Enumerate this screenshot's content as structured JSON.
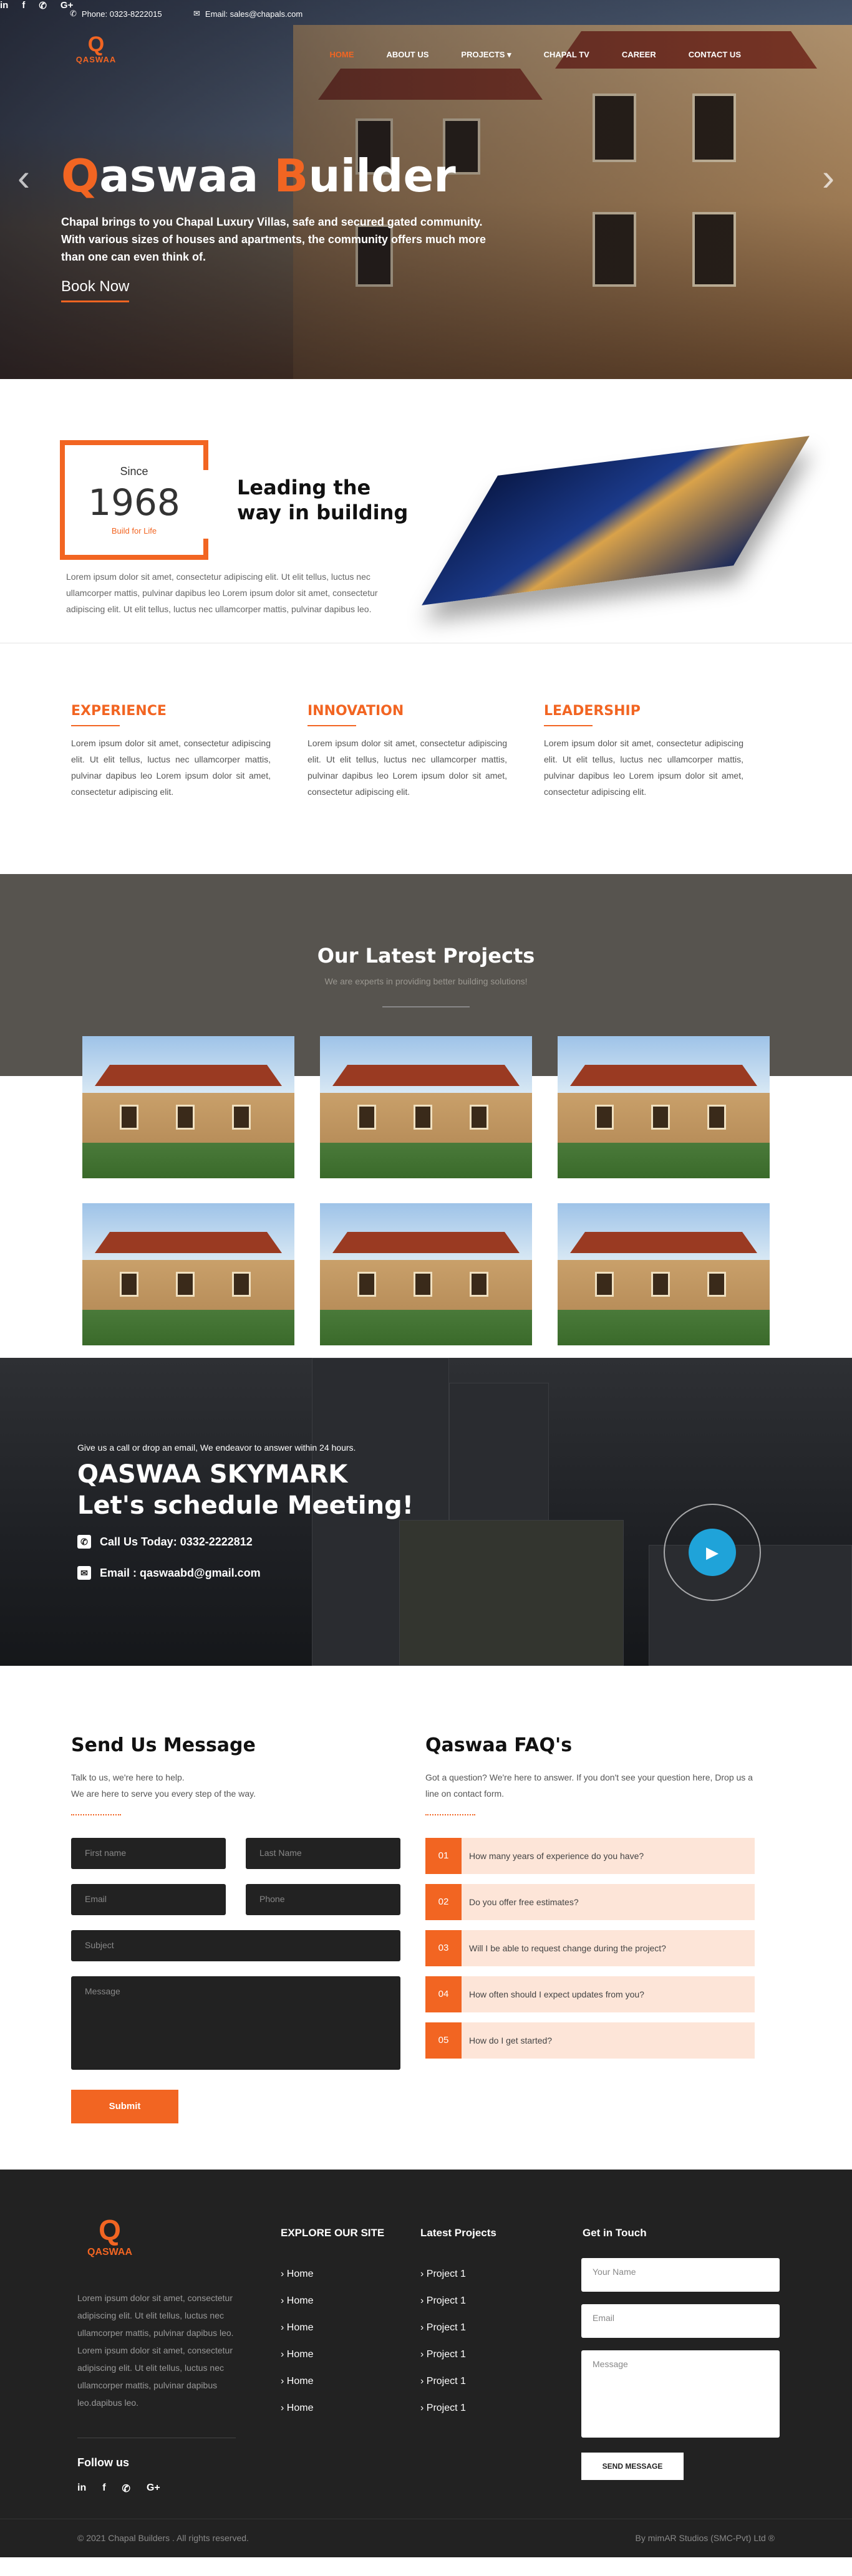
{
  "topbar": {
    "phone": "Phone: 0323-8222015",
    "email": "Email: sales@chapals.com",
    "social": [
      "in",
      "f",
      "✆",
      "G+"
    ]
  },
  "header": {
    "logo_mark": "Q",
    "logo_text": "QASWAA",
    "nav": [
      "HOME",
      "ABOUT US",
      "PROJECTS ▾",
      "CHAPAL TV",
      "CAREER",
      "CONTACT US"
    ]
  },
  "hero": {
    "title_q": "Q",
    "title_rest1": "aswaa ",
    "title_b": "B",
    "title_rest2": "uilder",
    "subtitle": "Chapal brings to you Chapal Luxury Villas, safe and secured gated community. With various sizes of houses and apartments, the community offers much more than one can even think of.",
    "button": "Book Now"
  },
  "about": {
    "since_label": "Since",
    "since_year": "1968",
    "since_tag": "Build for Life",
    "heading_l1": "Leading the",
    "heading_l2": "way in building",
    "text": "Lorem ipsum dolor sit amet, consectetur adipiscing elit. Ut elit tellus, luctus nec ullamcorper mattis, pulvinar dapibus leo Lorem ipsum dolor sit amet, consectetur adipiscing elit. Ut elit tellus, luctus nec ullamcorper mattis, pulvinar dapibus leo."
  },
  "features": [
    {
      "title": "EXPERIENCE",
      "text": "Lorem ipsum dolor sit amet, consectetur adipiscing elit. Ut elit tellus, luctus nec ullamcorper mattis, pulvinar dapibus leo Lorem ipsum dolor sit amet, consectetur adipiscing elit."
    },
    {
      "title": "INNOVATION",
      "text": "Lorem ipsum dolor sit amet, consectetur adipiscing elit. Ut elit tellus, luctus nec ullamcorper mattis, pulvinar dapibus leo Lorem ipsum dolor sit amet, consectetur adipiscing elit."
    },
    {
      "title": "LEADERSHIP",
      "text": "Lorem ipsum dolor sit amet, consectetur adipiscing elit. Ut elit tellus, luctus nec ullamcorper mattis, pulvinar dapibus leo Lorem ipsum dolor sit amet, consectetur adipiscing elit."
    }
  ],
  "projects": {
    "title": "Our Latest Projects",
    "subtitle": "We are experts in providing better building solutions!"
  },
  "meeting": {
    "intro": "Give us a call or drop an email, We endeavor to answer within 24 hours.",
    "title_l1": "QASWAA SKYMARK",
    "title_l2": "Let's schedule Meeting!",
    "call": "Call Us Today: 0332-2222812",
    "email": "Email : qaswaabd@gmail.com"
  },
  "contact": {
    "title": "Send Us Message",
    "desc_l1": "Talk to us, we're here to help.",
    "desc_l2": "We are here to serve you every step of the way.",
    "first_name": "First name",
    "last_name": "Last Name",
    "email": "Email",
    "phone": "Phone",
    "subject": "Subject",
    "message": "Message",
    "submit": "Submit"
  },
  "faq": {
    "title": "Qaswaa FAQ's",
    "desc": "Got a question? We're here to answer. If you don't see your question here, Drop us a line on contact form.",
    "items": [
      {
        "n": "01",
        "q": "How many years of experience do you have?"
      },
      {
        "n": "02",
        "q": "Do you offer free estimates?"
      },
      {
        "n": "03",
        "q": "Will I be able to request change during the project?"
      },
      {
        "n": "04",
        "q": "How often should I expect updates from you?"
      },
      {
        "n": "05",
        "q": "How do I get started?"
      }
    ]
  },
  "footer": {
    "logo_mark": "Q",
    "logo_text": "QASWAA",
    "about": "Lorem ipsum dolor sit amet, consectetur adipiscing elit. Ut elit tellus, luctus nec ullamcorper mattis, pulvinar dapibus leo. Lorem ipsum dolor sit amet, consectetur adipiscing elit. Ut elit tellus, luctus nec ullamcorper mattis, pulvinar dapibus leo.dapibus leo.",
    "follow": "Follow us",
    "social": [
      "in",
      "f",
      "✆",
      "G+"
    ],
    "explore_title": "EXPLORE OUR SITE",
    "explore": [
      "Home",
      "Home",
      "Home",
      "Home",
      "Home",
      "Home"
    ],
    "latest_title": "Latest Projects",
    "latest": [
      "Project 1",
      "Project 1",
      "Project 1",
      "Project 1",
      "Project 1",
      "Project 1"
    ],
    "touch_title": "Get in Touch",
    "your_name": "Your Name",
    "email": "Email",
    "message": "Message",
    "send": "SEND MESSAGE",
    "copyright": "© 2021 Chapal Builders . All rights reserved.",
    "credit": "By mimAR Studios (SMC-Pvt) Ltd ®"
  },
  "colors": {
    "accent": "#f26522",
    "dark": "#222222",
    "faq_bg": "#fde5d8",
    "play": "#1fa3d9"
  }
}
